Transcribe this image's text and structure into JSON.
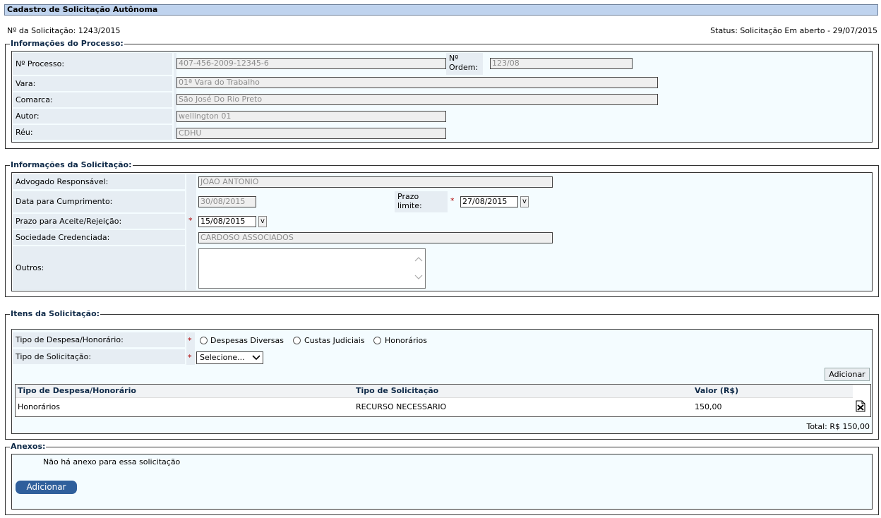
{
  "title": "Cadastro de Solicitação Autônoma",
  "header": {
    "request_number": "Nº da Solicitação: 1243/2015",
    "status": "Status: Solicitação Em aberto - 29/07/2015"
  },
  "process_info": {
    "legend": "Informações do Processo:",
    "process_number_label": "Nº Processo:",
    "process_number_value": "407-456-2009-12345-6",
    "order_label_line1": "Nº",
    "order_label_line2": "Ordem:",
    "order_value": "123/08",
    "vara_label": "Vara:",
    "vara_value": "01ª Vara do Trabalho",
    "comarca_label": "Comarca:",
    "comarca_value": "São José Do Rio Preto",
    "autor_label": "Autor:",
    "autor_value": "wellington 01",
    "reu_label": "Réu:",
    "reu_value": "CDHU"
  },
  "request_info": {
    "legend": "Informações da Solicitação:",
    "lawyer_label": "Advogado Responsável:",
    "lawyer_value": "JOAO ANTONIO",
    "due_date_label": "Data para Cumprimento:",
    "due_date_value": "30/08/2015",
    "deadline_label_line1": "Prazo",
    "deadline_label_line2": "limite:",
    "deadline_value": "27/08/2015",
    "accept_deadline_label": "Prazo para Aceite/Rejeição:",
    "accept_deadline_value": "15/08/2015",
    "society_label": "Sociedade Credenciada:",
    "society_value": "CARDOSO ASSOCIADOS",
    "others_label": "Outros:",
    "others_value": "",
    "calendar_button_label": "v",
    "required_mark": "*"
  },
  "items": {
    "legend": "Itens da Solicitação:",
    "expense_type_label": "Tipo de Despesa/Honorário:",
    "radio_options": [
      "Despesas Diversas",
      "Custas Judiciais",
      "Honorários"
    ],
    "request_type_label": "Tipo de Solicitação:",
    "request_type_selected": "Selecione...",
    "add_button": "Adicionar",
    "table": {
      "headers": [
        "Tipo de Despesa/Honorário",
        "Tipo de Solicitação",
        "Valor (R$)"
      ],
      "rows": [
        {
          "expense_type": "Honorários",
          "request_type": "RECURSO NECESSARIO",
          "value": "150,00"
        }
      ]
    },
    "total": "Total: R$ 150,00"
  },
  "attachments": {
    "legend": "Anexos:",
    "empty_message": "Não há anexo para essa solicitação",
    "add_button": "Adicionar"
  },
  "colors": {
    "title_bg": "#bfd3ee",
    "panel_bg": "#f4fcff",
    "label_bg": "#e6edf3",
    "legend_text": "#0f2a48",
    "required": "#b00000",
    "primary_button": "#2f5f9c"
  }
}
